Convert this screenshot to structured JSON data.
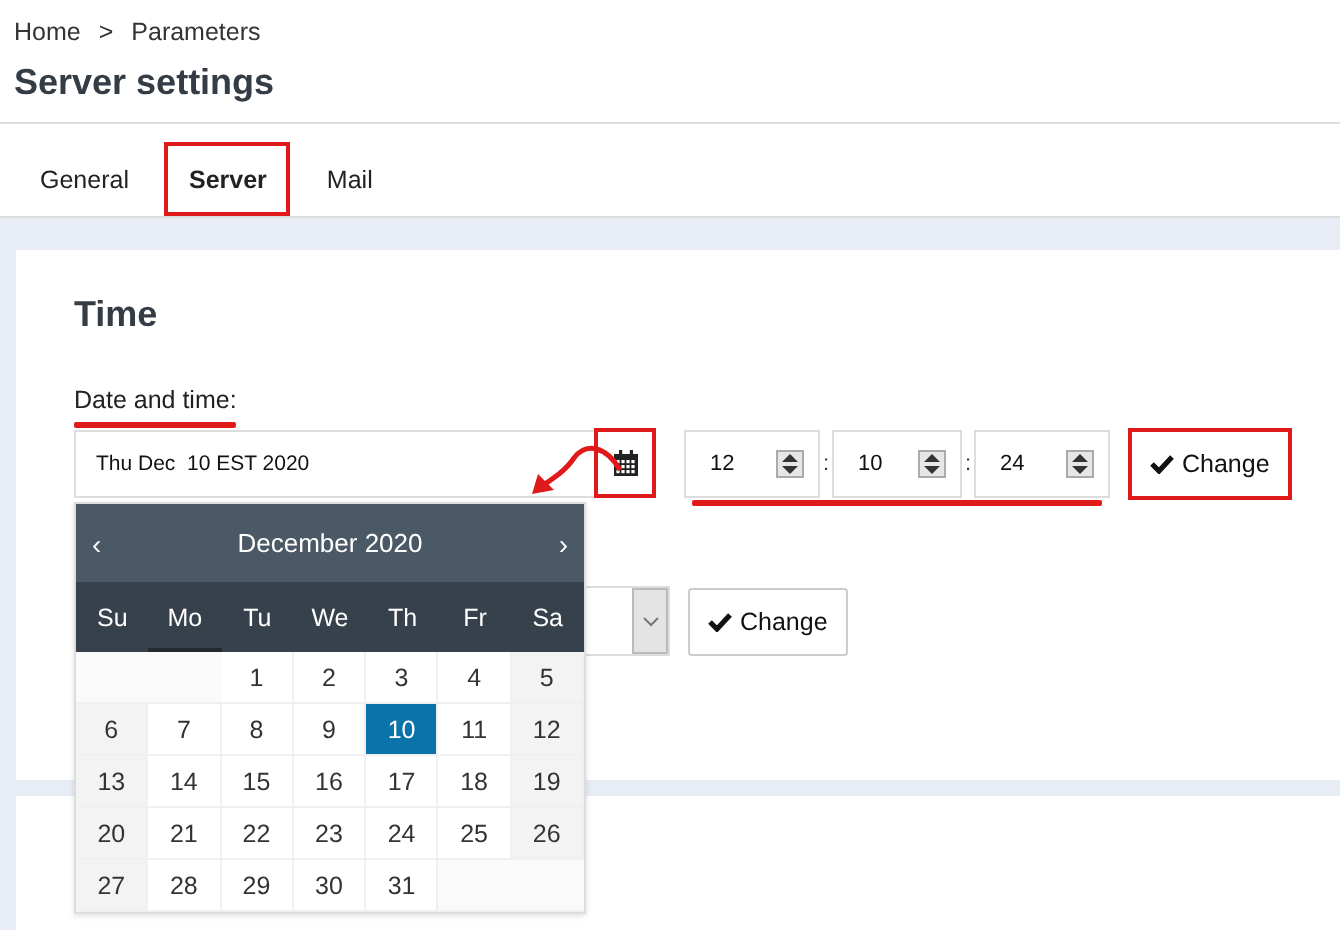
{
  "breadcrumb": [
    "Home",
    ">",
    "Parameters"
  ],
  "title": "Server settings",
  "tabs": [
    {
      "label": "General",
      "selected": false,
      "highlighted": false
    },
    {
      "label": "Server",
      "selected": true,
      "highlighted": true
    },
    {
      "label": "Mail",
      "selected": false,
      "highlighted": false
    }
  ],
  "section": {
    "title": "Time",
    "label": "Date and time:",
    "label_underlined": true,
    "date_value": "Thu Dec  10 EST 2020",
    "calendar_button_highlighted": true,
    "arrow_annotation": true,
    "time": {
      "fields": [
        "12",
        "10",
        "24"
      ],
      "separators": [
        ":",
        ":"
      ],
      "underlined": true
    },
    "change_button": {
      "label": "Change",
      "highlighted": true
    },
    "second_change_button": {
      "label": "Change",
      "highlighted": false
    }
  },
  "calendar": {
    "prev": "‹",
    "month": "December 2020",
    "next": "›",
    "weekdays": [
      {
        "label": "Su",
        "selected": false
      },
      {
        "label": "Mo",
        "selected": true
      },
      {
        "label": "Tu",
        "selected": false
      },
      {
        "label": "We",
        "selected": false
      },
      {
        "label": "Th",
        "selected": false
      },
      {
        "label": "Fr",
        "selected": false
      },
      {
        "label": "Sa",
        "selected": false
      }
    ],
    "weeks": [
      [
        {
          "kind": "blank"
        },
        {
          "kind": "blank"
        },
        {
          "kind": "day",
          "day": "1",
          "selected": false
        },
        {
          "kind": "day",
          "day": "2",
          "selected": false
        },
        {
          "kind": "day",
          "day": "3",
          "selected": false
        },
        {
          "kind": "day",
          "day": "4",
          "selected": false
        },
        {
          "kind": "day",
          "day": "5",
          "selected": false
        }
      ],
      [
        {
          "kind": "day",
          "day": "6",
          "selected": false
        },
        {
          "kind": "day",
          "day": "7",
          "selected": false
        },
        {
          "kind": "day",
          "day": "8",
          "selected": false
        },
        {
          "kind": "day",
          "day": "9",
          "selected": false
        },
        {
          "kind": "day",
          "day": "10",
          "selected": true
        },
        {
          "kind": "day",
          "day": "11",
          "selected": false
        },
        {
          "kind": "day",
          "day": "12",
          "selected": false
        }
      ],
      [
        {
          "kind": "day",
          "day": "13",
          "selected": false
        },
        {
          "kind": "day",
          "day": "14",
          "selected": false
        },
        {
          "kind": "day",
          "day": "15",
          "selected": false
        },
        {
          "kind": "day",
          "day": "16",
          "selected": false
        },
        {
          "kind": "day",
          "day": "17",
          "selected": false
        },
        {
          "kind": "day",
          "day": "18",
          "selected": false
        },
        {
          "kind": "day",
          "day": "19",
          "selected": false
        }
      ],
      [
        {
          "kind": "day",
          "day": "20",
          "selected": false
        },
        {
          "kind": "day",
          "day": "21",
          "selected": false
        },
        {
          "kind": "day",
          "day": "22",
          "selected": false
        },
        {
          "kind": "day",
          "day": "23",
          "selected": false
        },
        {
          "kind": "day",
          "day": "24",
          "selected": false
        },
        {
          "kind": "day",
          "day": "25",
          "selected": false
        },
        {
          "kind": "day",
          "day": "26",
          "selected": false
        }
      ],
      [
        {
          "kind": "day",
          "day": "27",
          "selected": false
        },
        {
          "kind": "day",
          "day": "28",
          "selected": false
        },
        {
          "kind": "day",
          "day": "29",
          "selected": false
        },
        {
          "kind": "day",
          "day": "30",
          "selected": false
        },
        {
          "kind": "day",
          "day": "31",
          "selected": false
        },
        {
          "kind": "blank"
        },
        {
          "kind": "blank"
        }
      ]
    ]
  }
}
